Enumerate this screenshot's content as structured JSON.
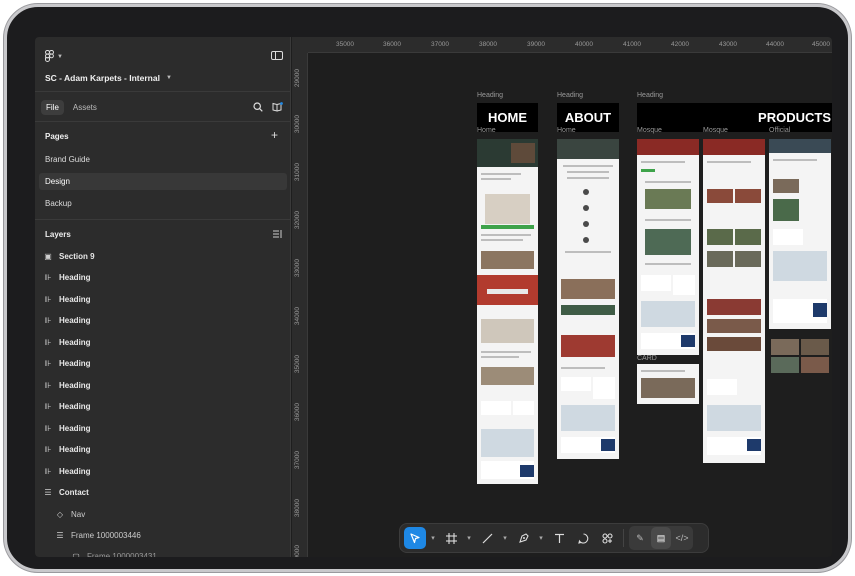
{
  "app": {
    "file_title": "SC - Adam Karpets - Internal",
    "tabs": [
      "File",
      "Assets"
    ]
  },
  "pages": {
    "label": "Pages",
    "items": [
      "Brand Guide",
      "Design",
      "Backup"
    ],
    "selected": "Design"
  },
  "layers": {
    "label": "Layers",
    "items": [
      {
        "label": "Section 9",
        "icon": "frame-icon"
      },
      {
        "label": "Heading",
        "icon": "auto-layout-icon"
      },
      {
        "label": "Heading",
        "icon": "auto-layout-icon"
      },
      {
        "label": "Heading",
        "icon": "auto-layout-icon"
      },
      {
        "label": "Heading",
        "icon": "auto-layout-icon"
      },
      {
        "label": "Heading",
        "icon": "auto-layout-icon"
      },
      {
        "label": "Heading",
        "icon": "auto-layout-icon"
      },
      {
        "label": "Heading",
        "icon": "auto-layout-icon"
      },
      {
        "label": "Heading",
        "icon": "auto-layout-icon"
      },
      {
        "label": "Heading",
        "icon": "auto-layout-icon"
      },
      {
        "label": "Heading",
        "icon": "auto-layout-icon"
      },
      {
        "label": "Contact",
        "icon": "stack-icon"
      },
      {
        "label": "Nav",
        "icon": "component-icon"
      },
      {
        "label": "Frame 1000003446",
        "icon": "stack-icon"
      },
      {
        "label": "Frame 1000003431",
        "icon": "frame-icon"
      }
    ]
  },
  "rulers": {
    "top": [
      "35000",
      "36000",
      "37000",
      "38000",
      "39000",
      "40000",
      "41000",
      "42000",
      "43000",
      "44000",
      "45000"
    ],
    "left": [
      "29000",
      "30000",
      "31000",
      "32000",
      "33000",
      "34000",
      "35000",
      "36000",
      "37000",
      "38000",
      "39000"
    ]
  },
  "canvas": {
    "headings": [
      {
        "label": "Heading",
        "text": "HOME"
      },
      {
        "label": "Heading",
        "text": "ABOUT"
      },
      {
        "label": "Heading",
        "text": "PRODUCTS"
      }
    ],
    "frames": [
      "Home",
      "Home",
      "Mosque",
      "Mosque",
      "Official"
    ],
    "extra_label": "CARD"
  },
  "toolbar": {
    "tools": [
      "move-tool",
      "frame-tool",
      "pen-line-tool",
      "pen-tool",
      "text-tool",
      "comment-tool",
      "actions-tool"
    ],
    "modes": [
      "draw-mode",
      "design-mode",
      "dev-mode"
    ],
    "active_tool": "move-tool",
    "active_mode": "design-mode"
  },
  "colors": {
    "accent": "#1e88e5",
    "panel": "#2c2c2c",
    "canvas": "#1e1e1e"
  }
}
